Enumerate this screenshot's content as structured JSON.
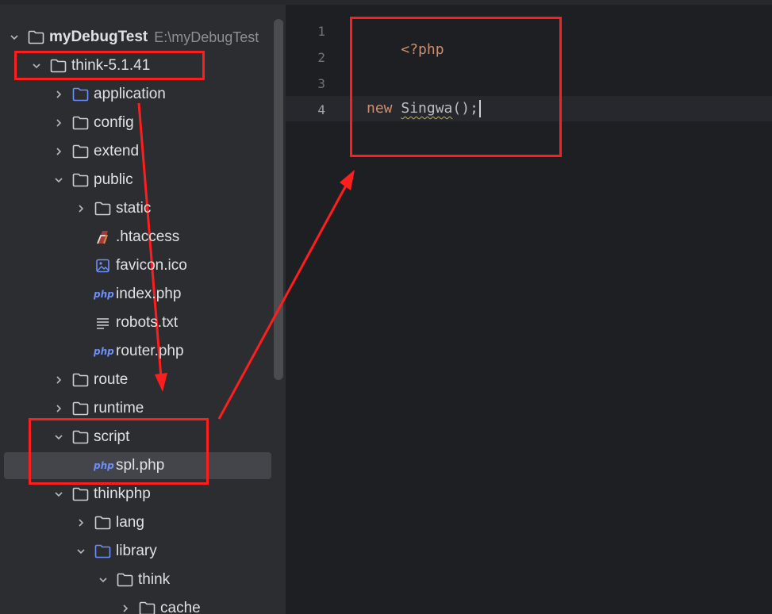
{
  "project": {
    "name": "myDebugTest",
    "path": "E:\\myDebugTest"
  },
  "tree": [
    {
      "label": "think-5.1.41",
      "icon": "folder-icon",
      "expanded": true
    },
    {
      "label": "application",
      "icon": "folder-blue-icon",
      "expanded": false
    },
    {
      "label": "config",
      "icon": "folder-icon",
      "expanded": false
    },
    {
      "label": "extend",
      "icon": "folder-icon",
      "expanded": false
    },
    {
      "label": "public",
      "icon": "folder-icon",
      "expanded": true
    },
    {
      "label": "static",
      "icon": "folder-icon",
      "expanded": false
    },
    {
      "label": ".htaccess",
      "icon": "htaccess-file-icon"
    },
    {
      "label": "favicon.ico",
      "icon": "image-file-icon"
    },
    {
      "label": "index.php",
      "icon": "php-file-icon"
    },
    {
      "label": "robots.txt",
      "icon": "text-file-icon"
    },
    {
      "label": "router.php",
      "icon": "php-file-icon"
    },
    {
      "label": "route",
      "icon": "folder-icon",
      "expanded": false
    },
    {
      "label": "runtime",
      "icon": "folder-icon",
      "expanded": false
    },
    {
      "label": "script",
      "icon": "folder-icon",
      "expanded": true
    },
    {
      "label": "spl.php",
      "icon": "php-file-icon",
      "selected": true
    },
    {
      "label": "thinkphp",
      "icon": "folder-icon",
      "expanded": true
    },
    {
      "label": "lang",
      "icon": "folder-icon",
      "expanded": false
    },
    {
      "label": "library",
      "icon": "folder-blue-icon",
      "expanded": true
    },
    {
      "label": "think",
      "icon": "folder-icon",
      "expanded": true
    },
    {
      "label": "cache",
      "icon": "folder-icon",
      "expanded": false
    }
  ],
  "php_badge": "php",
  "editor": {
    "line_numbers": [
      "1",
      "2",
      "3",
      "4"
    ],
    "active_line": "4",
    "code": {
      "open_tag": "<?php",
      "keyword_new": "new",
      "class_name": "Singwa",
      "call_suffix": "();"
    }
  },
  "colors": {
    "annotation_red": "#ff1e1e",
    "keyword": "#cf8e6d",
    "folder_blue": "#6e8ff7"
  }
}
